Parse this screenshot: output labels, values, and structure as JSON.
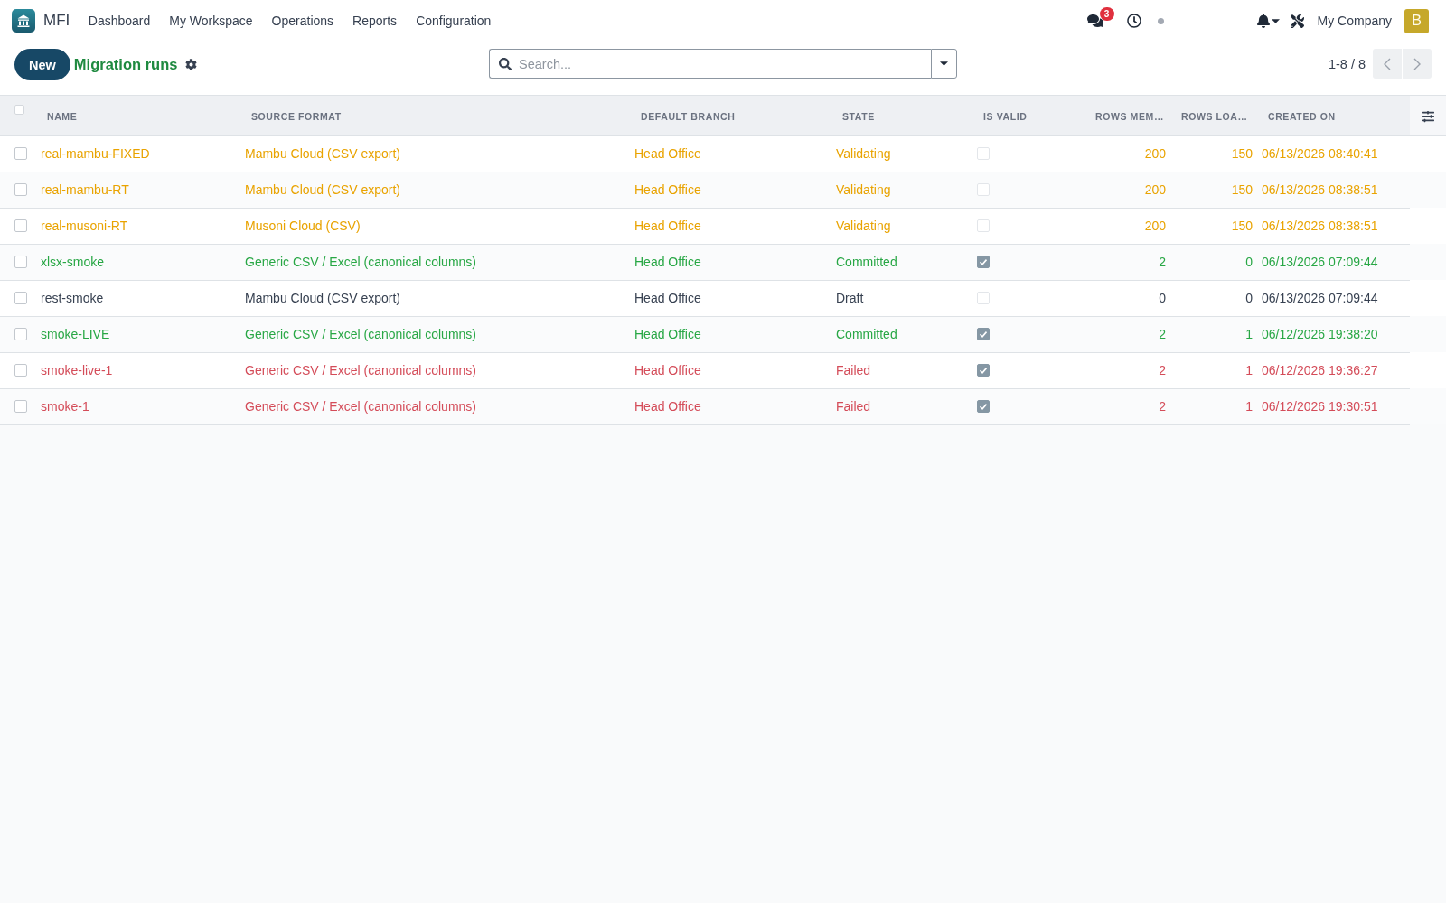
{
  "navbar": {
    "app_name": "MFI",
    "menu": [
      "Dashboard",
      "My Workspace",
      "Operations",
      "Reports",
      "Configuration"
    ],
    "message_count": "3",
    "company": "My Company",
    "avatar_initial": "B"
  },
  "control_panel": {
    "new_button": "New",
    "title": "Migration runs",
    "search": {
      "placeholder": "Search..."
    },
    "pager": "1-8 / 8"
  },
  "table": {
    "all_selected": false,
    "columns": [
      {
        "label": "NAME",
        "kind": "text"
      },
      {
        "label": "SOURCE FORMAT",
        "kind": "text"
      },
      {
        "label": "DEFAULT BRANCH",
        "kind": "text"
      },
      {
        "label": "STATE",
        "kind": "text"
      },
      {
        "label": "IS VALID",
        "kind": "check"
      },
      {
        "label": "ROWS MEM…",
        "kind": "number"
      },
      {
        "label": "ROWS LOA…",
        "kind": "number"
      },
      {
        "label": "CREATED ON",
        "kind": "text"
      }
    ],
    "rows": [
      {
        "selected": false,
        "color": "#e9a300",
        "name": "real-mambu-FIXED",
        "source_format": "Mambu Cloud (CSV export)",
        "default_branch": "Head Office",
        "state": "Validating",
        "is_valid": false,
        "column_6": "200",
        "column_7": "150",
        "created_on": "06/13/2026 08:40:41"
      },
      {
        "selected": false,
        "color": "#e9a300",
        "name": "real-mambu-RT",
        "source_format": "Mambu Cloud (CSV export)",
        "default_branch": "Head Office",
        "state": "Validating",
        "is_valid": false,
        "column_6": "200",
        "column_7": "150",
        "created_on": "06/13/2026 08:38:51"
      },
      {
        "selected": false,
        "color": "#e9a300",
        "name": "real-musoni-RT",
        "source_format": "Musoni Cloud (CSV)",
        "default_branch": "Head Office",
        "state": "Validating",
        "is_valid": false,
        "column_6": "200",
        "column_7": "150",
        "created_on": "06/13/2026 08:38:51"
      },
      {
        "selected": false,
        "color": "#28a745",
        "name": "xlsx-smoke",
        "source_format": "Generic CSV / Excel (canonical columns)",
        "default_branch": "Head Office",
        "state": "Committed",
        "is_valid": true,
        "column_6": "2",
        "column_7": "0",
        "created_on": "06/13/2026 07:09:44"
      },
      {
        "selected": false,
        "color": "#374151",
        "name": "rest-smoke",
        "source_format": "Mambu Cloud (CSV export)",
        "default_branch": "Head Office",
        "state": "Draft",
        "is_valid": false,
        "column_6": "0",
        "column_7": "0",
        "created_on": "06/13/2026 07:09:44"
      },
      {
        "selected": false,
        "color": "#28a745",
        "name": "smoke-LIVE",
        "source_format": "Generic CSV / Excel (canonical columns)",
        "default_branch": "Head Office",
        "state": "Committed",
        "is_valid": true,
        "column_6": "2",
        "column_7": "1",
        "created_on": "06/12/2026 19:38:20"
      },
      {
        "selected": false,
        "color": "#d44c59",
        "name": "smoke-live-1",
        "source_format": "Generic CSV / Excel (canonical columns)",
        "default_branch": "Head Office",
        "state": "Failed",
        "is_valid": true,
        "column_6": "2",
        "column_7": "1",
        "created_on": "06/12/2026 19:36:27"
      },
      {
        "selected": false,
        "color": "#d44c59",
        "name": "smoke-1",
        "source_format": "Generic CSV / Excel (canonical columns)",
        "default_branch": "Head Office",
        "state": "Failed",
        "is_valid": true,
        "column_6": "2",
        "column_7": "1",
        "created_on": "06/12/2026 19:30:51"
      }
    ]
  }
}
